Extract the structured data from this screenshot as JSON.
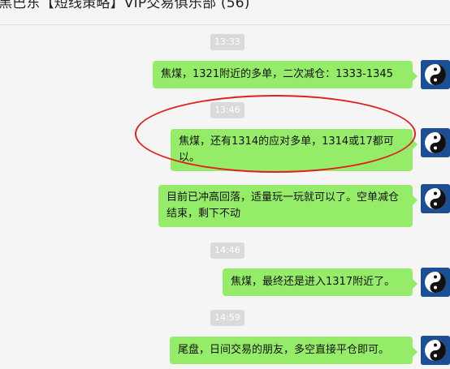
{
  "window": {
    "title": "黑巴东【短线策略】VIP交易俱乐部 (56)"
  },
  "messages": [
    {
      "time": "13:33",
      "text": "焦煤，1321附近的多单，二次减仓：1333-1345"
    },
    {
      "time": "13:46",
      "text": "焦煤，还有1314的应对多单，1314或17都可以。"
    },
    {
      "time": "",
      "text": "目前已冲高回落，适量玩一玩就可以了。空单减仓结束，剩下不动"
    },
    {
      "time": "14:46",
      "text": "焦煤，最终还是进入1317附近了。"
    },
    {
      "time": "14:59",
      "text": "尾盘，日间交易的朋友，多空直接平仓即可。"
    }
  ],
  "colors": {
    "bubble": "#95ec69",
    "annotation": "#e02020",
    "timestamp_bg": "#dadada"
  },
  "icons": {
    "avatar": "yin-yang-avatar-icon"
  }
}
